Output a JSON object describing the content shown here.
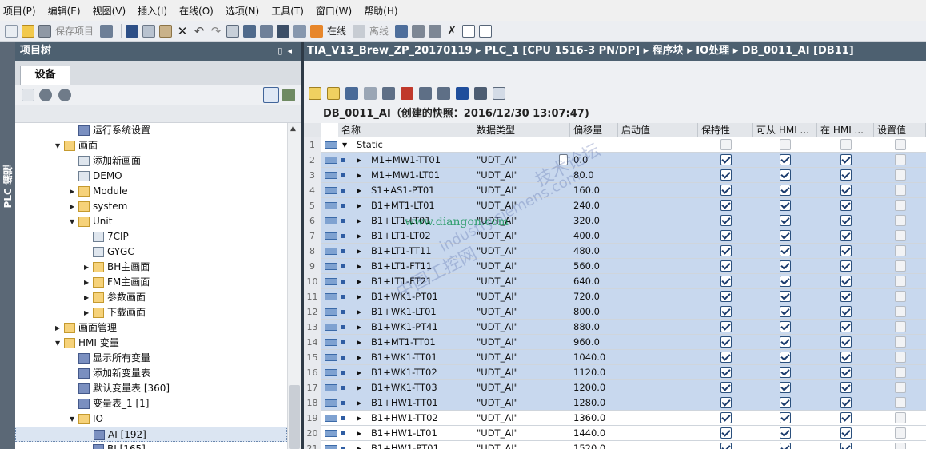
{
  "menu": [
    "项目(P)",
    "编辑(E)",
    "视图(V)",
    "插入(I)",
    "在线(O)",
    "选项(N)",
    "工具(T)",
    "窗口(W)",
    "帮助(H)"
  ],
  "toolbar": {
    "save_project": "保存项目",
    "go_online": "在线",
    "go_offline": "离线"
  },
  "side_tab": "PLC 编程",
  "tree": {
    "title": "项目树",
    "tab": "设备",
    "items": [
      {
        "label": "运行系统设置",
        "level": 3,
        "icon": "runtime-settings-icon",
        "arrow": ""
      },
      {
        "label": "画面",
        "level": 2,
        "icon": "folder-icon",
        "arrow": "down"
      },
      {
        "label": "添加新画面",
        "level": 3,
        "icon": "add-screen-icon",
        "arrow": ""
      },
      {
        "label": "DEMO",
        "level": 3,
        "icon": "screen-icon",
        "arrow": ""
      },
      {
        "label": "Module",
        "level": 3,
        "icon": "folder-icon",
        "arrow": "right"
      },
      {
        "label": "system",
        "level": 3,
        "icon": "folder-icon",
        "arrow": "right"
      },
      {
        "label": "Unit",
        "level": 3,
        "icon": "folder-icon",
        "arrow": "down"
      },
      {
        "label": "7CIP",
        "level": 4,
        "icon": "screen-icon",
        "arrow": ""
      },
      {
        "label": "GYGC",
        "level": 4,
        "icon": "screen-icon",
        "arrow": ""
      },
      {
        "label": "BH主画面",
        "level": 4,
        "icon": "folder-icon",
        "arrow": "right"
      },
      {
        "label": "FM主画面",
        "level": 4,
        "icon": "folder-icon",
        "arrow": "right"
      },
      {
        "label": "参数画面",
        "level": 4,
        "icon": "folder-icon",
        "arrow": "right"
      },
      {
        "label": "下载画面",
        "level": 4,
        "icon": "folder-icon",
        "arrow": "right"
      },
      {
        "label": "画面管理",
        "level": 2,
        "icon": "folder-icon",
        "arrow": "right"
      },
      {
        "label": "HMI 变量",
        "level": 2,
        "icon": "folder-icon",
        "arrow": "down"
      },
      {
        "label": "显示所有变量",
        "level": 3,
        "icon": "tag-table-icon",
        "arrow": ""
      },
      {
        "label": "添加新变量表",
        "level": 3,
        "icon": "add-tag-table-icon",
        "arrow": ""
      },
      {
        "label": "默认变量表 [360]",
        "level": 3,
        "icon": "tag-table-icon",
        "arrow": ""
      },
      {
        "label": "变量表_1 [1]",
        "level": 3,
        "icon": "tag-table-icon",
        "arrow": ""
      },
      {
        "label": "IO",
        "level": 3,
        "icon": "folder-icon",
        "arrow": "down"
      },
      {
        "label": "AI [192]",
        "level": 4,
        "icon": "tag-table-icon",
        "arrow": "",
        "selected": true
      },
      {
        "label": "BI [165]",
        "level": 4,
        "icon": "tag-table-icon",
        "arrow": ""
      }
    ]
  },
  "breadcrumb": [
    "TIA_V13_Brew_ZP_20170119",
    "PLC_1 [CPU 1516-3 PN/DP]",
    "程序块",
    "IO处理",
    "DB_0011_AI [DB11]"
  ],
  "db_title": "DB_0011_AI（创建的快照：2016/12/30 13:07:47)",
  "grid": {
    "headers": [
      "名称",
      "数据类型",
      "偏移量",
      "启动值",
      "保持性",
      "可从 HMI ...",
      "在 HMI ...",
      "设置值"
    ],
    "static_label": "Static",
    "rows": [
      {
        "name": "M1+MW1-TT01",
        "type": "\"UDT_AI\"",
        "offset": "0.0"
      },
      {
        "name": "M1+MW1-LT01",
        "type": "\"UDT_AI\"",
        "offset": "80.0"
      },
      {
        "name": "S1+AS1-PT01",
        "type": "\"UDT_AI\"",
        "offset": "160.0"
      },
      {
        "name": "B1+MT1-LT01",
        "type": "\"UDT_AI\"",
        "offset": "240.0"
      },
      {
        "name": "B1+LT1-LT01",
        "type": "\"UDT_AI\"",
        "offset": "320.0"
      },
      {
        "name": "B1+LT1-LT02",
        "type": "\"UDT_AI\"",
        "offset": "400.0"
      },
      {
        "name": "B1+LT1-TT11",
        "type": "\"UDT_AI\"",
        "offset": "480.0"
      },
      {
        "name": "B1+LT1-FT11",
        "type": "\"UDT_AI\"",
        "offset": "560.0"
      },
      {
        "name": "B1+LT1-FT21",
        "type": "\"UDT_AI\"",
        "offset": "640.0"
      },
      {
        "name": "B1+WK1-PT01",
        "type": "\"UDT_AI\"",
        "offset": "720.0"
      },
      {
        "name": "B1+WK1-LT01",
        "type": "\"UDT_AI\"",
        "offset": "800.0"
      },
      {
        "name": "B1+WK1-PT41",
        "type": "\"UDT_AI\"",
        "offset": "880.0"
      },
      {
        "name": "B1+MT1-TT01",
        "type": "\"UDT_AI\"",
        "offset": "960.0"
      },
      {
        "name": "B1+WK1-TT01",
        "type": "\"UDT_AI\"",
        "offset": "1040.0"
      },
      {
        "name": "B1+WK1-TT02",
        "type": "\"UDT_AI\"",
        "offset": "1120.0"
      },
      {
        "name": "B1+WK1-TT03",
        "type": "\"UDT_AI\"",
        "offset": "1200.0"
      },
      {
        "name": "B1+HW1-TT01",
        "type": "\"UDT_AI\"",
        "offset": "1280.0"
      },
      {
        "name": "B1+HW1-TT02",
        "type": "\"UDT_AI\"",
        "offset": "1360.0"
      },
      {
        "name": "B1+HW1-LT01",
        "type": "\"UDT_AI\"",
        "offset": "1440.0"
      },
      {
        "name": "B1+HW1-PT01",
        "type": "\"UDT_AI\"",
        "offset": "1520.0"
      }
    ]
  },
  "watermark": {
    "site": "www.diangon.com",
    "text1": "中国工控网",
    "text2": "技术论坛",
    "text3": "industry.siemens.com"
  },
  "colors": {
    "header_bar": "#4d6070",
    "selection": "#c8d8ee",
    "checkbox_border": "#2a4f7c"
  }
}
